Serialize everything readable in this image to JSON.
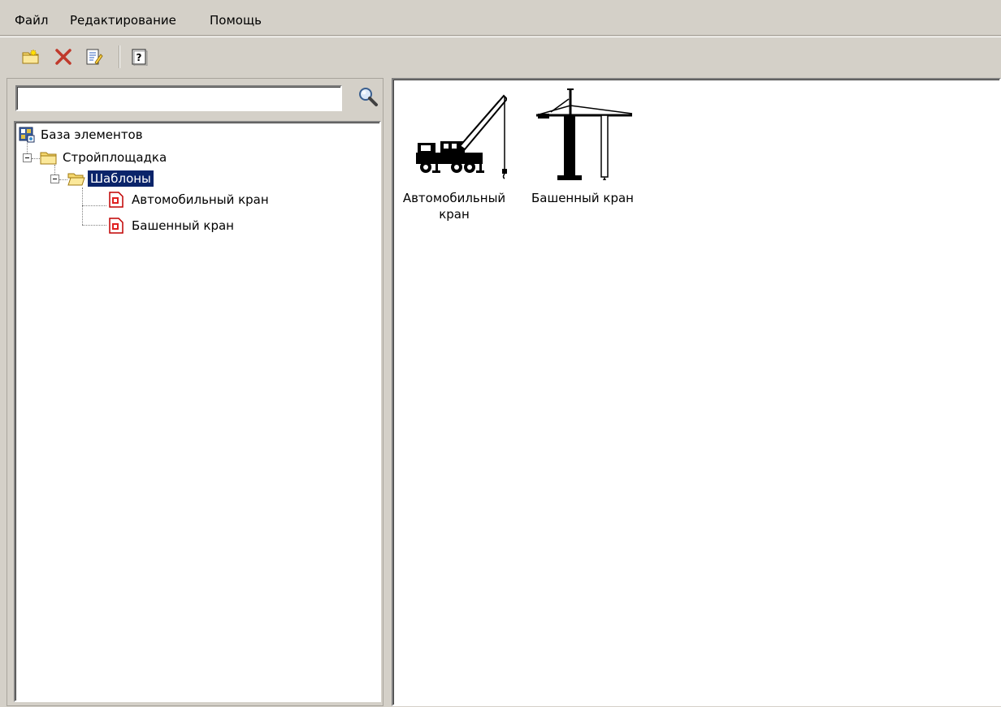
{
  "menu": {
    "file": "Файл",
    "edit": "Редактирование",
    "help": "Помощь"
  },
  "toolbar": {
    "buttons": [
      "new-folder-icon",
      "delete-icon",
      "edit-icon",
      "help-icon"
    ]
  },
  "search": {
    "value": "",
    "placeholder": ""
  },
  "tree": {
    "root": "База элементов",
    "folder": "Стройплощадка",
    "subfolder": "Шаблоны",
    "items": [
      "Автомобильный кран",
      "Башенный кран"
    ]
  },
  "content": {
    "items": [
      {
        "label": "Автомобильный кран",
        "icon": "mobile-crane-icon"
      },
      {
        "label": "Башенный кран",
        "icon": "tower-crane-icon"
      }
    ]
  },
  "colors": {
    "window_bg": "#d4d0c8",
    "selection_bg": "#0a246a",
    "delete_red": "#c0392b",
    "folder_yellow": "#f5d76e"
  }
}
